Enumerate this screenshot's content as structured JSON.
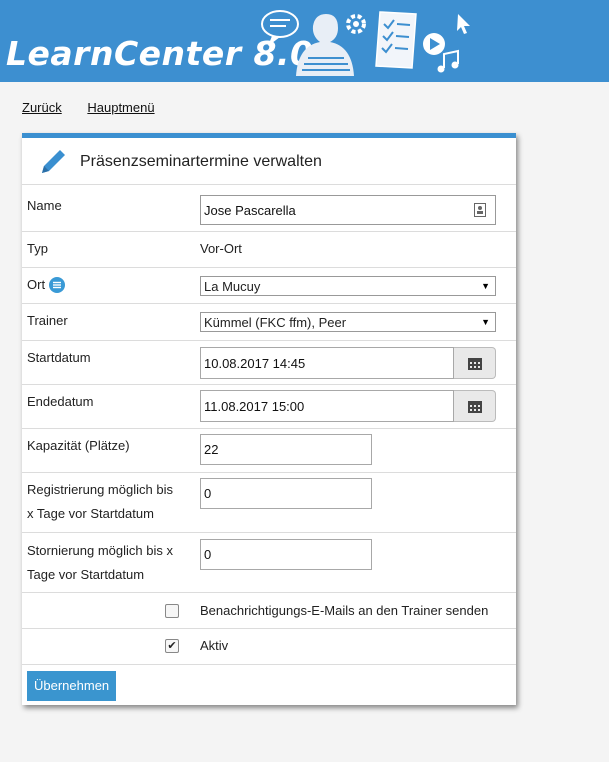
{
  "header": {
    "logo_text": "LearnCenter 8.0"
  },
  "nav": {
    "back_label": "Zurück",
    "main_menu_label": "Hauptmenü"
  },
  "panel": {
    "title": "Präsenzseminartermine verwalten",
    "fields": {
      "name": {
        "label": "Name",
        "value": "Jose Pascarella"
      },
      "typ": {
        "label": "Typ",
        "value": "Vor-Ort"
      },
      "ort": {
        "label": "Ort",
        "value": "La Mucuy"
      },
      "trainer": {
        "label": "Trainer",
        "value": "Kümmel (FKC ffm), Peer"
      },
      "startdatum": {
        "label": "Startdatum",
        "value": "10.08.2017 14:45"
      },
      "endedatum": {
        "label": "Endedatum",
        "value": "11.08.2017 15:00"
      },
      "kapazitaet": {
        "label": "Kapazität (Plätze)",
        "value": "22"
      },
      "registrierung": {
        "label_line1": "Registrierung möglich bis",
        "label_line2": "x Tage vor Startdatum",
        "value": "0"
      },
      "stornierung": {
        "label_line1": "Stornierung möglich bis x",
        "label_line2": "Tage vor Startdatum",
        "value": "0"
      },
      "notify": {
        "label": "Benachrichtigungs-E-Mails an den Trainer senden",
        "checked": false
      },
      "aktiv": {
        "label": "Aktiv",
        "checked": true
      }
    },
    "submit_label": "Übernehmen"
  },
  "colors": {
    "header_bg": "#3d8fd0",
    "accent": "#3a95cf",
    "page_bg": "#f4f4f4"
  }
}
